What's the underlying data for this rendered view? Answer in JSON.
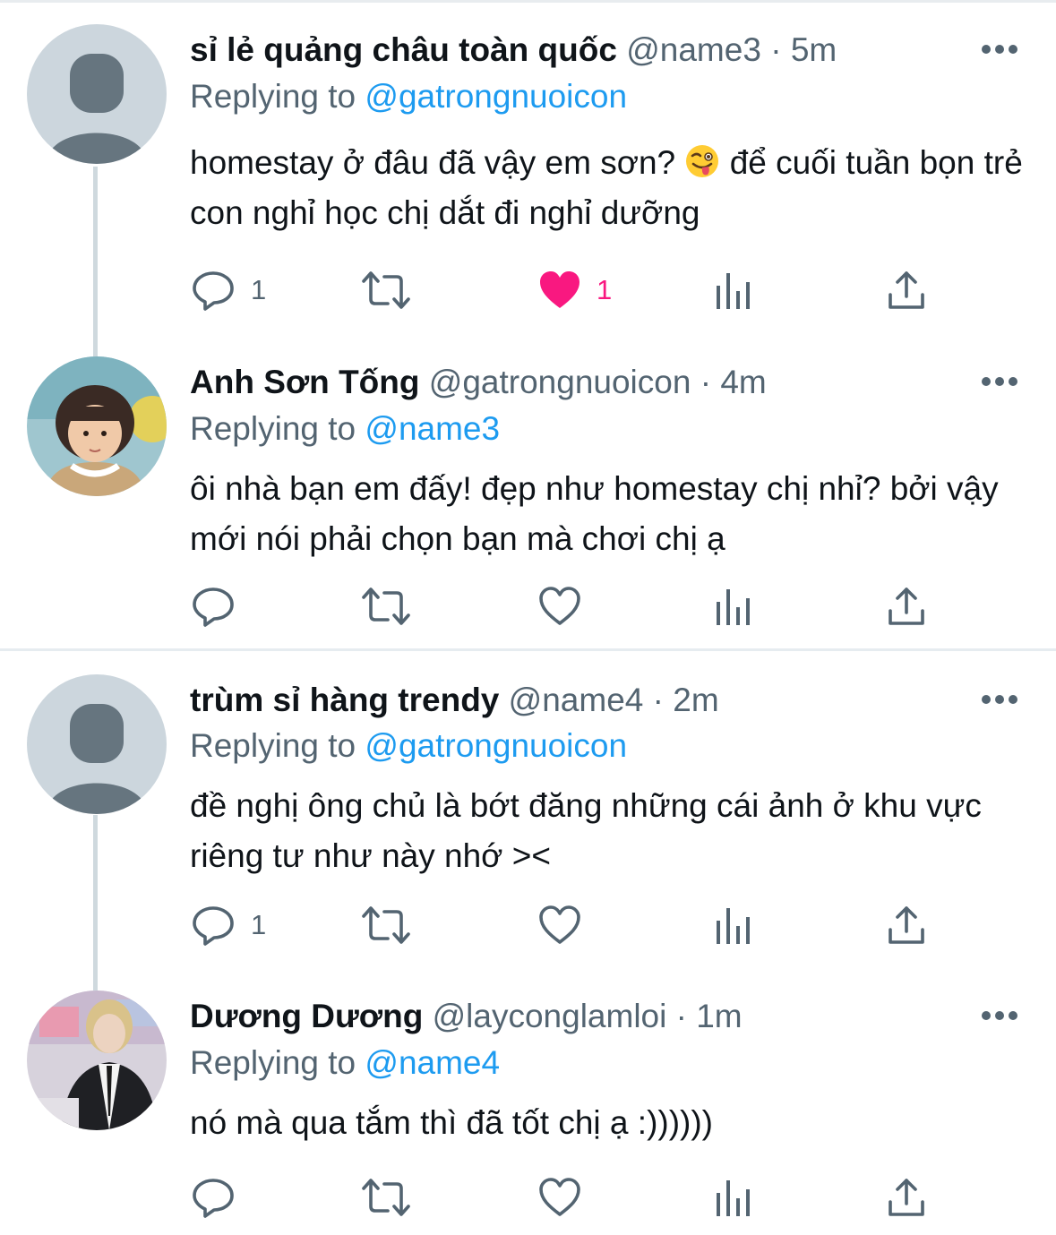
{
  "colors": {
    "accent": "#1d9bf0",
    "like_active": "#f91880",
    "muted_text": "#536471",
    "text": "#0f1419"
  },
  "tweets": [
    {
      "display_name": "sỉ lẻ quảng châu toàn quốc",
      "handle": "@name3",
      "separator": "·",
      "time": "5m",
      "replying_label": "Replying to",
      "replying_to": "@gatrongnuoicon",
      "text_before_emoji": "homestay ở đâu đã vậy em sơn? ",
      "emoji": "winking-face-with-tongue",
      "text_after_emoji": " để cuối tuần bọn trẻ con nghỉ học chị dắt đi nghỉ dưỡng",
      "avatar": "default-avatar",
      "actions": {
        "reply_count": "1",
        "retweet_count": "",
        "like_count": "1",
        "liked": true
      }
    },
    {
      "display_name": "Anh Sơn Tống",
      "handle": "@gatrongnuoicon",
      "separator": "·",
      "time": "4m",
      "replying_label": "Replying to",
      "replying_to": "@name3",
      "text": "ôi nhà bạn em đấy! đẹp như homestay chị nhỉ? bởi vậy mới nói phải chọn bạn mà chơi chị ạ",
      "avatar": "child-photo-avatar",
      "actions": {
        "reply_count": "",
        "retweet_count": "",
        "like_count": "",
        "liked": false
      }
    },
    {
      "display_name": "trùm sỉ hàng trendy",
      "handle": "@name4",
      "separator": "·",
      "time": "2m",
      "replying_label": "Replying to",
      "replying_to": "@gatrongnuoicon",
      "text": "đề nghị ông chủ là bớt đăng những cái ảnh ở khu vực riêng tư như này nhớ ><",
      "avatar": "default-avatar",
      "actions": {
        "reply_count": "1",
        "retweet_count": "",
        "like_count": "",
        "liked": false
      }
    },
    {
      "display_name": "Dương Dương",
      "handle": "@layconglamloi",
      "separator": "·",
      "time": "1m",
      "replying_label": "Replying to",
      "replying_to": "@name4",
      "text": "nó mà qua tắm thì đã tốt chị ạ :))))))",
      "avatar": "person-photo-avatar",
      "actions": {
        "reply_count": "",
        "retweet_count": "",
        "like_count": "",
        "liked": false
      }
    }
  ]
}
